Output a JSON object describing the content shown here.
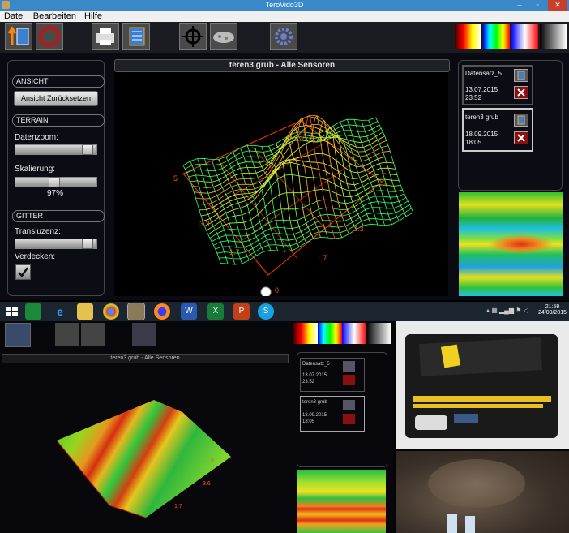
{
  "window": {
    "title": "TeroVido3D",
    "min": "–",
    "max": "▫",
    "close": "✕"
  },
  "menu": [
    "Datei",
    "Bearbeiten",
    "Hilfe"
  ],
  "viewport": {
    "title": "teren3 grub - Alle Sensoren",
    "axis_labels": {
      "y_top": "5",
      "y_mid": "3.3",
      "y_low": "1.7",
      "x_low": "1.7",
      "x_mid": "3.3",
      "x_top": "5",
      "origin": "0"
    }
  },
  "left_panel": {
    "ansicht_header": "ANSICHT",
    "reset_button": "Ansicht Zurücksetzen",
    "terrain_header": "TERRAIN",
    "datenzoom_label": "Datenzoom:",
    "datenzoom_value": 0.95,
    "skalierung_label": "Skalierung:",
    "skalierung_value": 0.48,
    "skalierung_percent": "97%",
    "gitter_header": "GITTER",
    "transluzenz_label": "Transluzenz:",
    "transluzenz_value": 0.95,
    "verdecken_label": "Verdecken:",
    "verdecken_checked": true
  },
  "datasets": [
    {
      "name": "Datensatz_5",
      "date": "13.07.2015",
      "time": "23:52",
      "selected": false
    },
    {
      "name": "teren3 grub",
      "date": "18.09.2015",
      "time": "18:05",
      "selected": true
    }
  ],
  "taskbar": {
    "time": "21:59",
    "date": "24/09/2015"
  },
  "bottom": {
    "viewport_title": "teren3 grub - Alle Sensoren",
    "datasets": [
      {
        "name": "Datensatz_5",
        "date": "13.07.2015",
        "time": "23:52"
      },
      {
        "name": "teren3 grub",
        "date": "18.09.2015",
        "time": "18:05"
      }
    ],
    "axis_labels": [
      "5",
      "3.6",
      "1.7"
    ]
  },
  "colors": {
    "titlebar": "#3a88c8",
    "close": "#c7402c",
    "panel_bg": "#0c0c14",
    "wire_red": "#ff3300",
    "wire_green": "#33ff66"
  }
}
